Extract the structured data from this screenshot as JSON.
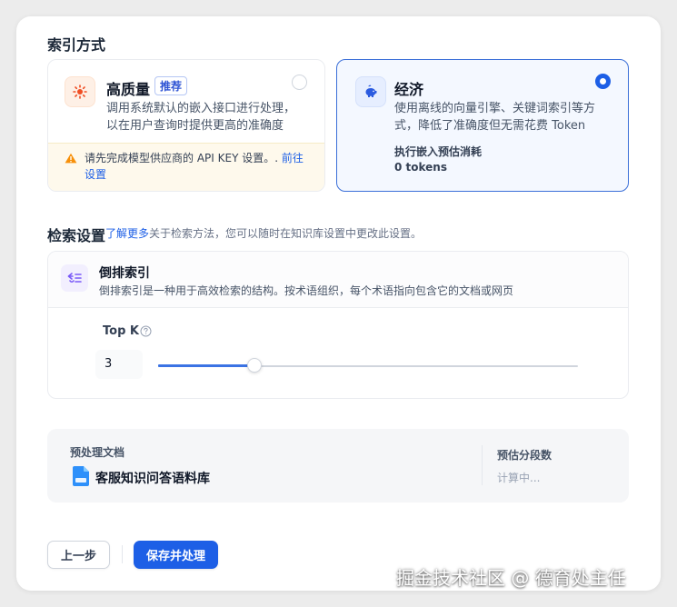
{
  "index_section": {
    "title": "索引方式",
    "high_quality": {
      "title": "高质量",
      "badge": "推荐",
      "desc_line1": "调用系统默认的嵌入接口进行处理，",
      "desc_line2": "以在用户查询时提供更高的准确度",
      "warning_text": "请先完成模型供应商的 API KEY 设置。.",
      "warning_link_1": "前往",
      "warning_link_2": "设置",
      "selected": false
    },
    "economy": {
      "title": "经济",
      "desc_line1": "使用离线的向量引擎、关键词索引等方",
      "desc_line2": "式，降低了准确度但无需花费 Token",
      "estimate_label": "执行嵌入预估消耗",
      "estimate_value": "0 tokens",
      "selected": true
    }
  },
  "retrieval": {
    "title": "检索设置",
    "learn_more": "了解更多",
    "note": "关于检索方法，您可以随时在知识库设置中更改此设置。",
    "method_name": "倒排索引",
    "method_desc": "倒排索引是一种用于高效检索的结构。按术语组织，每个术语指向包含它的文档或网页",
    "topk_label": "Top K",
    "topk_value": "3",
    "topk_level": 0.23
  },
  "preprocess": {
    "doc_label": "预处理文档",
    "doc_name": "客服知识问答语料库",
    "segments_label": "预估分段数",
    "segments_value": "计算中..."
  },
  "buttons": {
    "prev": "上一步",
    "save": "保存并处理"
  },
  "watermark": "掘金技术社区 @ 德育处主任",
  "colors": {
    "accent": "#1d5fe6",
    "selected_border": "#3b6fd8",
    "warning_bg": "#fef9ec",
    "warning_icon": "#f79009"
  }
}
